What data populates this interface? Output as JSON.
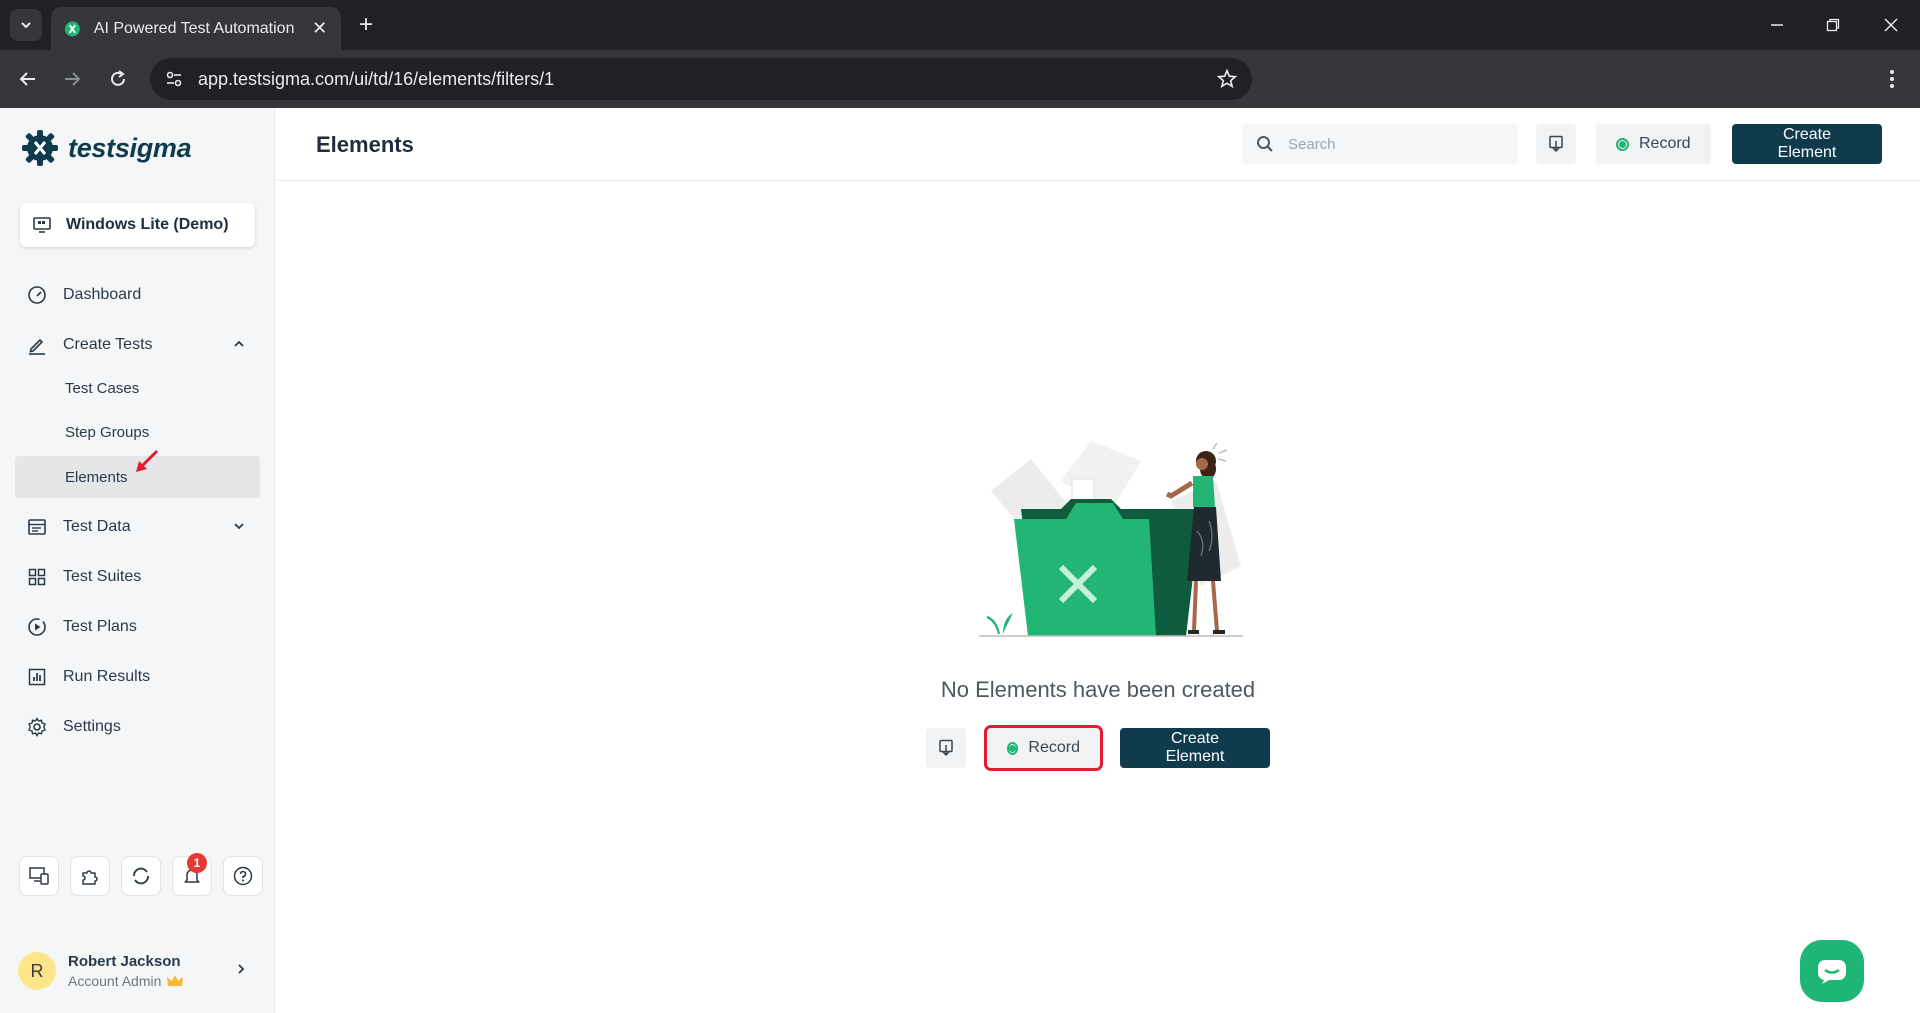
{
  "browser": {
    "tab_title": "AI Powered Test Automation Pla",
    "url": "app.testsigma.com/ui/td/16/elements/filters/1"
  },
  "sidebar": {
    "brand": "testsigma",
    "workspace": "Windows Lite (Demo)",
    "nav": {
      "dashboard": "Dashboard",
      "create_tests": "Create Tests",
      "test_cases": "Test Cases",
      "step_groups": "Step Groups",
      "elements": "Elements",
      "test_data": "Test Data",
      "test_suites": "Test Suites",
      "test_plans": "Test Plans",
      "run_results": "Run Results",
      "settings": "Settings"
    },
    "notification_count": "1",
    "user": {
      "initial": "R",
      "name": "Robert Jackson",
      "role": "Account Admin"
    }
  },
  "header": {
    "title": "Elements",
    "search_placeholder": "Search",
    "record_label": "Record",
    "create_label": "Create Element"
  },
  "empty_state": {
    "message": "No Elements have been created",
    "record_label": "Record",
    "create_label": "Create Element"
  },
  "colors": {
    "brand": "#0f3b4d",
    "accent": "#1fb574",
    "highlight": "#e11d2f"
  }
}
